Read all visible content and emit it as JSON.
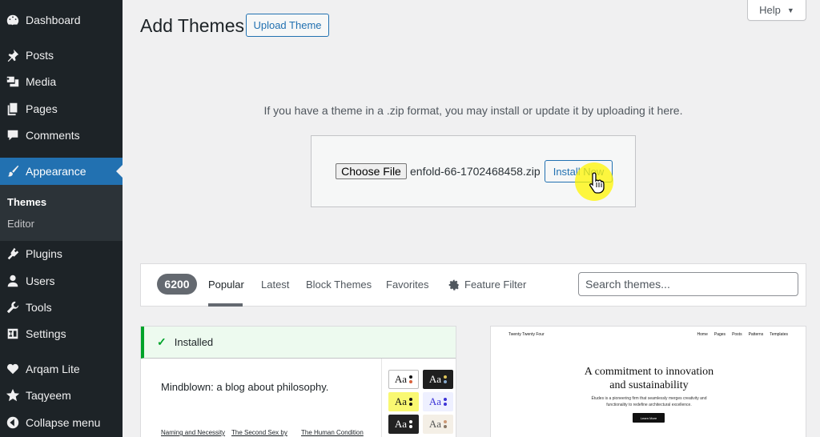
{
  "sidebar": {
    "items": [
      {
        "label": "Dashboard",
        "icon": "dashboard-icon"
      },
      {
        "label": "Posts",
        "icon": "pin-icon"
      },
      {
        "label": "Media",
        "icon": "media-icon"
      },
      {
        "label": "Pages",
        "icon": "pages-icon"
      },
      {
        "label": "Comments",
        "icon": "comment-icon"
      },
      {
        "label": "Appearance",
        "icon": "brush-icon",
        "active": true
      },
      {
        "label": "Plugins",
        "icon": "plugin-icon"
      },
      {
        "label": "Users",
        "icon": "user-icon"
      },
      {
        "label": "Tools",
        "icon": "wrench-icon"
      },
      {
        "label": "Settings",
        "icon": "settings-icon"
      },
      {
        "label": "Arqam Lite",
        "icon": "heart-icon"
      },
      {
        "label": "Taqyeem",
        "icon": "star-icon"
      },
      {
        "label": "Collapse menu",
        "icon": "collapse-icon"
      }
    ],
    "submenu": [
      {
        "label": "Themes",
        "current": true
      },
      {
        "label": "Editor"
      }
    ],
    "accent": "#2271b1",
    "background": "#1d2327"
  },
  "header": {
    "title": "Add Themes",
    "upload_label": "Upload Theme",
    "help_label": "Help"
  },
  "upload": {
    "description": "If you have a theme in a .zip format, you may install or update it by uploading it here.",
    "choose_file_label": "Choose File",
    "file_name": "enfold-66-1702468458.zip",
    "install_label": "Install Now"
  },
  "filter": {
    "count": "6200",
    "tabs": [
      "Popular",
      "Latest",
      "Block Themes",
      "Favorites"
    ],
    "current_tab": "Popular",
    "feature_filter_label": "Feature Filter",
    "search_placeholder": "Search themes..."
  },
  "themes": [
    {
      "installed_label": "Installed",
      "preview_title": "Mindblown: a blog about philosophy.",
      "preview_links": [
        "Naming and Necessity",
        "The Second Sex by",
        "The Human Condition"
      ],
      "swatch_label": "Aa"
    },
    {
      "preview_logo": "Twenty Twenty Four",
      "preview_nav": [
        "Home",
        "Pages",
        "Posts",
        "Patterns",
        "Templates"
      ],
      "preview_heading_line1": "A commitment to innovation",
      "preview_heading_line2": "and sustainability",
      "preview_body": "Études is a pioneering firm that seamlessly merges creativity and functionality to redefine architectural excellence.",
      "preview_button": "Learn More"
    }
  ]
}
